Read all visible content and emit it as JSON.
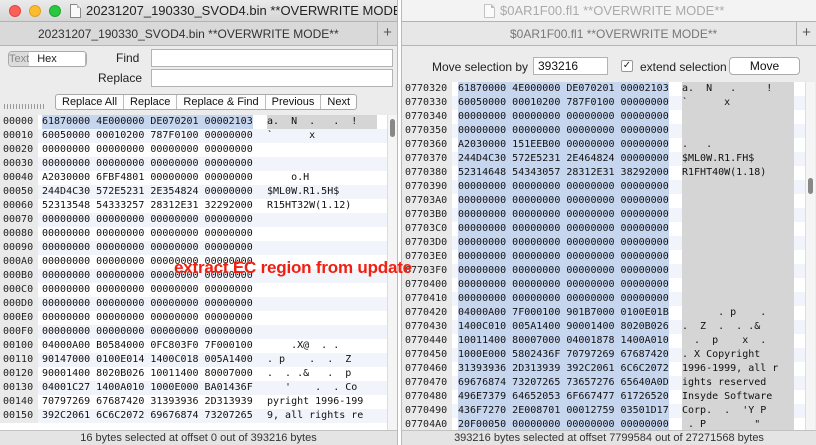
{
  "left": {
    "window_title": "20231207_190330_SVOD4.bin **OVERWRITE MODE**",
    "tab_title": "20231207_190330_SVOD4.bin **OVERWRITE MODE**",
    "mode_hex": "Hex",
    "mode_text": "Text",
    "find_label": "Find",
    "replace_label": "Replace",
    "find_value": "",
    "replace_value": "",
    "buttons": [
      "Replace All",
      "Replace",
      "Replace & Find",
      "Previous",
      "Next"
    ],
    "rows": [
      {
        "off": "00000",
        "hex": "61870000 4E000000 DE070201 00002103",
        "asc": "a.  N  .   .  !"
      },
      {
        "off": "00010",
        "hex": "60050000 00010200 787F0100 00000000",
        "asc": "`      x"
      },
      {
        "off": "00020",
        "hex": "00000000 00000000 00000000 00000000",
        "asc": ""
      },
      {
        "off": "00030",
        "hex": "00000000 00000000 00000000 00000000",
        "asc": ""
      },
      {
        "off": "00040",
        "hex": "A2030000 6FBF4801 00000000 00000000",
        "asc": "    o.H"
      },
      {
        "off": "00050",
        "hex": "244D4C30 572E5231 2E354824 00000000",
        "asc": "$ML0W.R1.5H$"
      },
      {
        "off": "00060",
        "hex": "52313548 54333257 28312E31 32292000",
        "asc": "R15HT32W(1.12)"
      },
      {
        "off": "00070",
        "hex": "00000000 00000000 00000000 00000000",
        "asc": ""
      },
      {
        "off": "00080",
        "hex": "00000000 00000000 00000000 00000000",
        "asc": ""
      },
      {
        "off": "00090",
        "hex": "00000000 00000000 00000000 00000000",
        "asc": ""
      },
      {
        "off": "000A0",
        "hex": "00000000 00000000 00000000 00000000",
        "asc": ""
      },
      {
        "off": "000B0",
        "hex": "00000000 00000000 00000000 00000000",
        "asc": ""
      },
      {
        "off": "000C0",
        "hex": "00000000 00000000 00000000 00000000",
        "asc": ""
      },
      {
        "off": "000D0",
        "hex": "00000000 00000000 00000000 00000000",
        "asc": ""
      },
      {
        "off": "000E0",
        "hex": "00000000 00000000 00000000 00000000",
        "asc": ""
      },
      {
        "off": "000F0",
        "hex": "00000000 00000000 00000000 00000000",
        "asc": ""
      },
      {
        "off": "00100",
        "hex": "04000A00 B0584000 0FC803F0 7F000100",
        "asc": "    .X@  . ."
      },
      {
        "off": "00110",
        "hex": "90147000 0100E014 1400C018 005A1400",
        "asc": ". p    .  .  Z"
      },
      {
        "off": "00120",
        "hex": "90001400 8020B026 10011400 80007000",
        "asc": ".  . .&   .  p"
      },
      {
        "off": "00130",
        "hex": "04001C27 1400A010 1000E000 BA01436F",
        "asc": "   '    .  . Co"
      },
      {
        "off": "00140",
        "hex": "70797269 67687420 31393936 2D313939",
        "asc": "pyright 1996-199"
      },
      {
        "off": "00150",
        "hex": "392C2061 6C6C2072 69676874 73207265",
        "asc": "9, all rights re"
      }
    ],
    "status": "16 bytes selected at offset 0 out of 393216 bytes"
  },
  "overlay_text": "extract EC region from update",
  "right": {
    "window_title": "$0AR1F00.fl1 **OVERWRITE MODE**",
    "tab_title": "$0AR1F00.fl1 **OVERWRITE MODE**",
    "move_label": "Move selection by",
    "move_value": "393216",
    "extend_label": "extend selection",
    "extend_checked": "✓",
    "move_button": "Move",
    "rows": [
      {
        "off": "0770320",
        "hex": "61870000 4E000000 DE070201 00002103",
        "asc": "a.  N   .     !"
      },
      {
        "off": "0770330",
        "hex": "60050000 00010200 787F0100 00000000",
        "asc": "`      x"
      },
      {
        "off": "0770340",
        "hex": "00000000 00000000 00000000 00000000",
        "asc": ""
      },
      {
        "off": "0770350",
        "hex": "00000000 00000000 00000000 00000000",
        "asc": ""
      },
      {
        "off": "0770360",
        "hex": "A2030000 151EEB00 00000000 00000000",
        "asc": ".   ."
      },
      {
        "off": "0770370",
        "hex": "244D4C30 572E5231 2E464824 00000000",
        "asc": "$ML0W.R1.FH$"
      },
      {
        "off": "0770380",
        "hex": "52314648 54343057 28312E31 38292000",
        "asc": "R1FHT40W(1.18)"
      },
      {
        "off": "0770390",
        "hex": "00000000 00000000 00000000 00000000",
        "asc": ""
      },
      {
        "off": "07703A0",
        "hex": "00000000 00000000 00000000 00000000",
        "asc": ""
      },
      {
        "off": "07703B0",
        "hex": "00000000 00000000 00000000 00000000",
        "asc": ""
      },
      {
        "off": "07703C0",
        "hex": "00000000 00000000 00000000 00000000",
        "asc": ""
      },
      {
        "off": "07703D0",
        "hex": "00000000 00000000 00000000 00000000",
        "asc": ""
      },
      {
        "off": "07703E0",
        "hex": "00000000 00000000 00000000 00000000",
        "asc": ""
      },
      {
        "off": "07703F0",
        "hex": "00000000 00000000 00000000 00000000",
        "asc": ""
      },
      {
        "off": "0770400",
        "hex": "00000000 00000000 00000000 00000000",
        "asc": ""
      },
      {
        "off": "0770410",
        "hex": "00000000 00000000 00000000 00000000",
        "asc": ""
      },
      {
        "off": "0770420",
        "hex": "04000A00 7F000100 901B7000 0100E01B",
        "asc": "      . p    ."
      },
      {
        "off": "0770430",
        "hex": "1400C010 005A1400 90001400 8020B026",
        "asc": ".  Z  .  . .&"
      },
      {
        "off": "0770440",
        "hex": "10011400 80007000 04001878 1400A010",
        "asc": "  .  p    x  ."
      },
      {
        "off": "0770450",
        "hex": "1000E000 5802436F 70797269 67687420",
        "asc": ". X Copyright"
      },
      {
        "off": "0770460",
        "hex": "31393936 2D313939 392C2061 6C6C2072",
        "asc": "1996-1999, all r"
      },
      {
        "off": "0770470",
        "hex": "69676874 73207265 73657276 65640A0D",
        "asc": "ights reserved"
      },
      {
        "off": "0770480",
        "hex": "496E7379 64652053 6F667477 61726520",
        "asc": "Insyde Software"
      },
      {
        "off": "0770490",
        "hex": "436F7270 2E008701 00012759 03501D17",
        "asc": "Corp.  .  'Y P"
      },
      {
        "off": "07704A0",
        "hex": "20F00050 00000000 00000000 00000000",
        "asc": " . P        \""
      }
    ],
    "status": "393216 bytes selected at offset 7799584 out of 27271568 bytes"
  }
}
